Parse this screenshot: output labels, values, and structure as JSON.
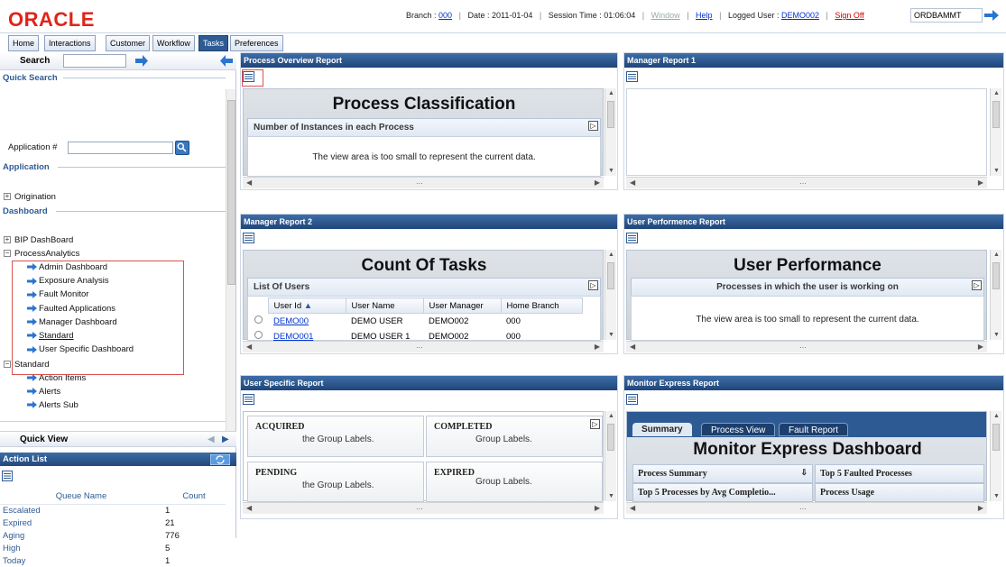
{
  "header": {
    "logo": "ORACLE",
    "branch_label": "Branch :",
    "branch": "000",
    "date_label": "Date : 2011-01-04",
    "session_label": "Session Time : 01:06:04",
    "window": "Window",
    "help": "Help",
    "logged_label": "Logged User :",
    "logged_user": "DEMO002",
    "sign_off": "Sign Off",
    "app_select": "ORDBAMMT"
  },
  "nav": {
    "tabs": [
      "Home",
      "Interactions",
      "Customer",
      "Workflow",
      "Tasks",
      "Preferences"
    ],
    "active": "Tasks"
  },
  "left": {
    "search_label": "Search",
    "search_value": "",
    "quick_search": "Quick Search",
    "app_num_label": "Application #",
    "application": "Application",
    "origination": "Origination",
    "dashboard": "Dashboard",
    "bip": "BIP DashBoard",
    "process_analytics": "ProcessAnalytics",
    "pa_items": [
      "Admin Dashboard",
      "Exposure Analysis",
      "Fault Monitor",
      "Faulted Applications",
      "Manager Dashboard",
      "Standard",
      "User Specific Dashboard"
    ],
    "standard": "Standard",
    "std_items": [
      "Action Items",
      "Alerts",
      "Alerts Sub"
    ],
    "quick_view": "Quick View",
    "action_list": "Action List",
    "col_queue": "Queue Name",
    "col_count": "Count",
    "rows": [
      {
        "name": "Escalated",
        "count": "1"
      },
      {
        "name": "Expired",
        "count": "21"
      },
      {
        "name": "Aging",
        "count": "776"
      },
      {
        "name": "High",
        "count": "5"
      },
      {
        "name": "Today",
        "count": "1"
      }
    ]
  },
  "panels": {
    "p1": {
      "header": "Process Overview Report",
      "title": "Process Classification",
      "sub": "Number of Instances in each Process",
      "msg": "The view area is too small to represent the current data."
    },
    "p2": {
      "header": "Manager Report 1"
    },
    "p3": {
      "header": "Manager Report 2",
      "title": "Count Of Tasks",
      "sub": "List Of Users",
      "cols": [
        "User Id",
        "User Name",
        "User Manager",
        "Home Branch"
      ],
      "rows": [
        [
          "DEMO00",
          "DEMO USER",
          "DEMO002",
          "000"
        ],
        [
          "DEMO001",
          "DEMO USER 1",
          "DEMO002",
          "000"
        ]
      ]
    },
    "p4": {
      "header": "User Performence Report",
      "title": "User Performance",
      "sub": "Processes in which the user is working on",
      "msg": "The view area is too small to represent the current data."
    },
    "p5": {
      "header": "User Specific Report",
      "cells": [
        "ACQUIRED",
        "COMPLETED",
        "PENDING",
        "EXPIRED"
      ],
      "s1": "the Group Labels.",
      "s2": "Group Labels.",
      "s3": "the Group Labels.",
      "s4": "Group Labels."
    },
    "p6": {
      "header": "Monitor  Express Report",
      "tabs": [
        "Summary",
        "Process View",
        "Fault Report"
      ],
      "title": "Monitor Express Dashboard",
      "cells": [
        "Process Summary",
        "Top 5 Faulted Processes",
        "Top 5 Processes by Avg Completio...",
        "Process Usage"
      ]
    }
  },
  "colors": {
    "brand": "#e2231a",
    "header_blue": "#2e5b94",
    "link": "#0033cc",
    "highlight_box": "#d9534f"
  },
  "icons": [
    "search-go-arrow-icon",
    "collapse-left-icon",
    "magnifier-icon",
    "expand-plus-icon",
    "blue-arrow-icon",
    "table-view-icon",
    "refresh-icon",
    "expand-box-icon",
    "sort-asc-icon"
  ]
}
